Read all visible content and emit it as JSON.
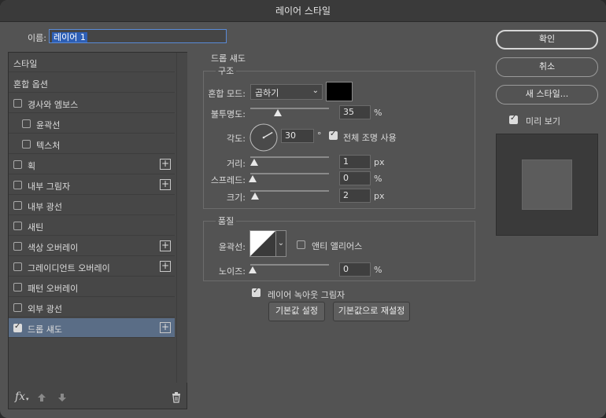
{
  "window": {
    "title": "레이어 스타일"
  },
  "name": {
    "label": "이름:",
    "value": "레이어 1"
  },
  "styles_list": {
    "items": [
      {
        "label": "스타일",
        "checkbox": false,
        "checked": false,
        "plus": false,
        "indent": false,
        "selected": false
      },
      {
        "label": "혼합 옵션",
        "checkbox": false,
        "checked": false,
        "plus": false,
        "indent": false,
        "selected": false
      },
      {
        "label": "경사와 엠보스",
        "checkbox": true,
        "checked": false,
        "plus": false,
        "indent": false,
        "selected": false
      },
      {
        "label": "윤곽선",
        "checkbox": true,
        "checked": false,
        "plus": false,
        "indent": true,
        "selected": false
      },
      {
        "label": "텍스처",
        "checkbox": true,
        "checked": false,
        "plus": false,
        "indent": true,
        "selected": false
      },
      {
        "label": "획",
        "checkbox": true,
        "checked": false,
        "plus": true,
        "indent": false,
        "selected": false
      },
      {
        "label": "내부 그림자",
        "checkbox": true,
        "checked": false,
        "plus": true,
        "indent": false,
        "selected": false
      },
      {
        "label": "내부 광선",
        "checkbox": true,
        "checked": false,
        "plus": false,
        "indent": false,
        "selected": false
      },
      {
        "label": "새틴",
        "checkbox": true,
        "checked": false,
        "plus": false,
        "indent": false,
        "selected": false
      },
      {
        "label": "색상 오버레이",
        "checkbox": true,
        "checked": false,
        "plus": true,
        "indent": false,
        "selected": false
      },
      {
        "label": "그레이디언트 오버레이",
        "checkbox": true,
        "checked": false,
        "plus": true,
        "indent": false,
        "selected": false
      },
      {
        "label": "패턴 오버레이",
        "checkbox": true,
        "checked": false,
        "plus": false,
        "indent": false,
        "selected": false
      },
      {
        "label": "외부 광선",
        "checkbox": true,
        "checked": false,
        "plus": false,
        "indent": false,
        "selected": false
      },
      {
        "label": "드롭 섀도",
        "checkbox": true,
        "checked": true,
        "plus": true,
        "indent": false,
        "selected": true
      }
    ],
    "footer": {
      "fx_label": "fx"
    }
  },
  "drop_shadow": {
    "section_title": "드롭 섀도",
    "structure": {
      "title": "구조",
      "blend_mode_label": "혼합 모드:",
      "blend_mode_value": "곱하기",
      "color": "#000000",
      "opacity_label": "불투명도:",
      "opacity_value": "35",
      "opacity_unit": "%",
      "opacity_fraction": 0.35,
      "angle_label": "각도:",
      "angle_value": "30",
      "angle_unit": "°",
      "global_light_label": "전체 조명 사용",
      "global_light_checked": true,
      "distance_label": "거리:",
      "distance_value": "1",
      "distance_unit": "px",
      "spread_label": "스프레드:",
      "spread_value": "0",
      "spread_unit": "%",
      "size_label": "크기:",
      "size_value": "2",
      "size_unit": "px"
    },
    "quality": {
      "title": "품질",
      "contour_label": "윤곽선:",
      "anti_alias_label": "앤티 앨리어스",
      "anti_alias_checked": false,
      "noise_label": "노이즈:",
      "noise_value": "0",
      "noise_unit": "%"
    },
    "layer_knocks_out_label": "레이어 녹아웃 그림자",
    "layer_knocks_out_checked": true,
    "make_default_label": "기본값 설정",
    "reset_default_label": "기본값으로 재설정"
  },
  "buttons": {
    "ok": "확인",
    "cancel": "취소",
    "new_style": "새 스타일...",
    "preview_label": "미리 보기",
    "preview_checked": true
  }
}
